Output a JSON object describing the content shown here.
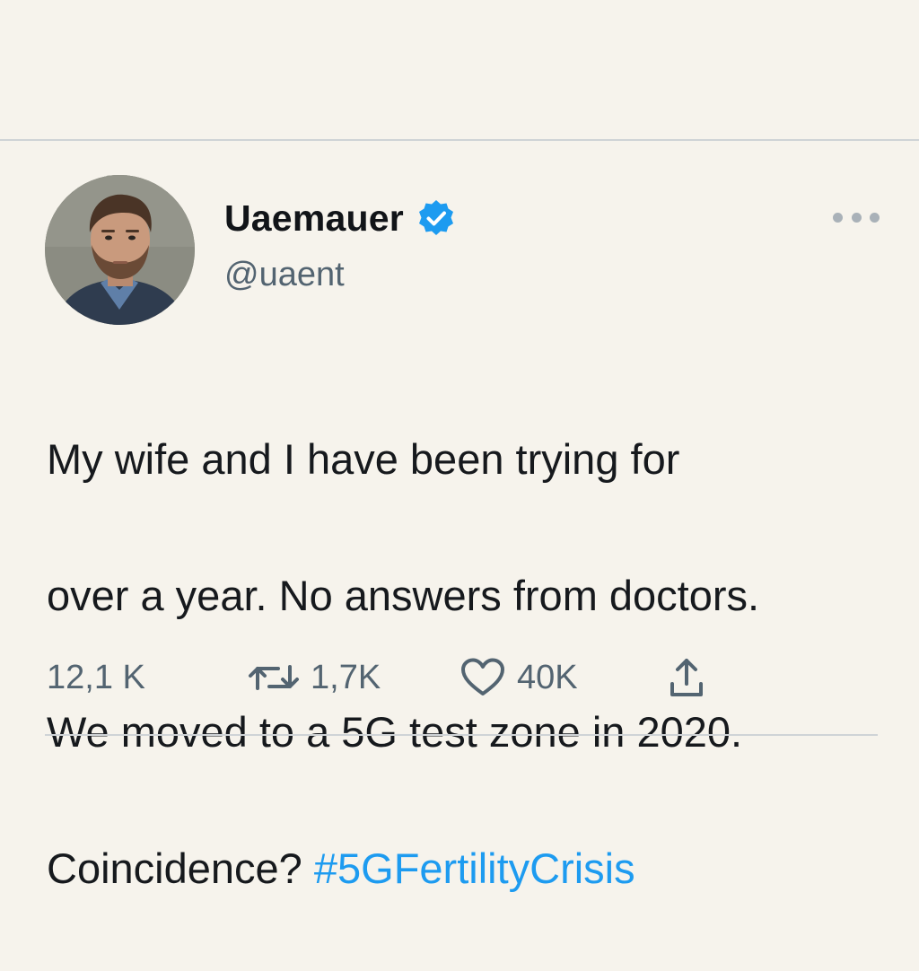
{
  "user": {
    "display_name": "Uaemauer",
    "handle": "@uaent",
    "verified": true,
    "avatar_icon": "user-avatar-photo"
  },
  "tweet": {
    "lines": [
      "My wife and I have been trying for",
      "over a year. No answers from doctors.",
      "We moved to a 5G test zone in 2020.",
      "Coincidence? "
    ],
    "hashtag": "#5GFertilityCrisis"
  },
  "stats": {
    "replies": "12,1 K",
    "retweets": "1,7K",
    "likes": "40K"
  },
  "icons": {
    "verified": "verified-badge-icon",
    "more": "more-options-icon",
    "retweet": "retweet-icon",
    "like": "heart-icon",
    "share": "share-icon"
  },
  "colors": {
    "background": "#f6f3ec",
    "text": "#16191d",
    "muted": "#536471",
    "accent": "#1d9bf0",
    "divider": "#cfd3d6"
  }
}
